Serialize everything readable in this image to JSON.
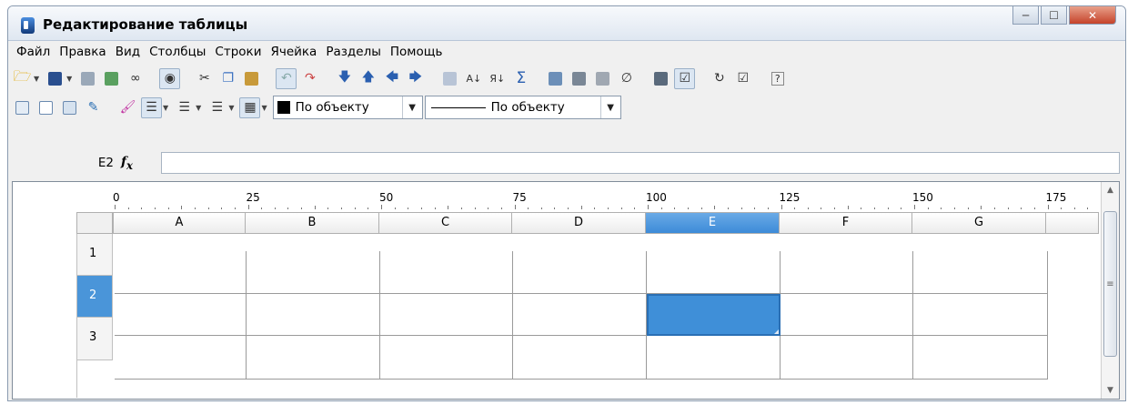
{
  "window": {
    "title": "Редактирование таблицы"
  },
  "menubar": [
    "Файл",
    "Правка",
    "Вид",
    "Столбцы",
    "Строки",
    "Ячейка",
    "Разделы",
    "Помощь"
  ],
  "toolbar2": {
    "color_combo": "По объекту",
    "line_combo": "По объекту"
  },
  "formula": {
    "cell_ref": "E2",
    "value": ""
  },
  "ruler": {
    "labels": [
      "0",
      "25",
      "50",
      "75",
      "100",
      "125",
      "150",
      "175"
    ]
  },
  "table": {
    "columns": [
      "A",
      "B",
      "C",
      "D",
      "E",
      "F",
      "G"
    ],
    "rows": [
      "1",
      "2",
      "3"
    ],
    "selected_column": "E",
    "selected_row": "2"
  },
  "colors": {
    "selection": "#3f8fd8",
    "header_selected": "#4a95d9"
  }
}
